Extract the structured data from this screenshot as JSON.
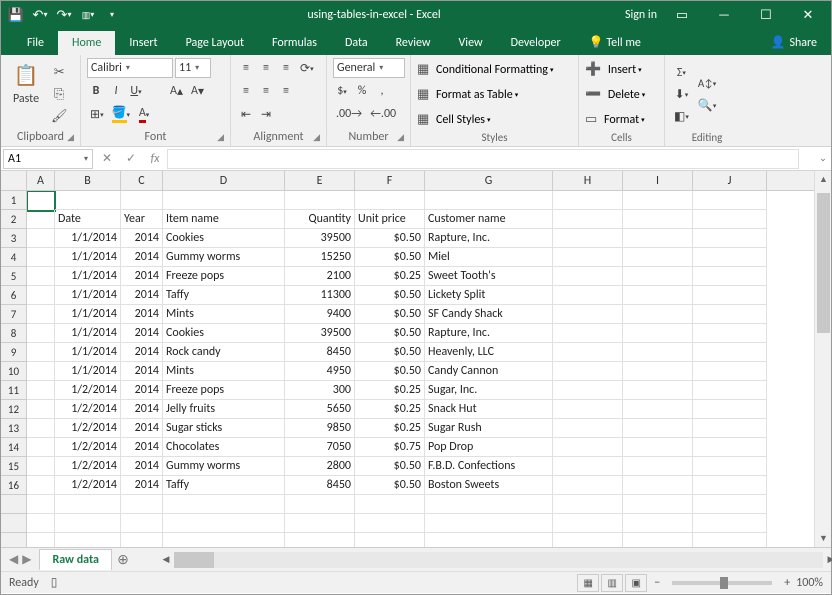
{
  "title": "using-tables-in-excel - Excel",
  "signin": "Sign in",
  "menu": {
    "file": "File",
    "home": "Home",
    "insert": "Insert",
    "pagelayout": "Page Layout",
    "formulas": "Formulas",
    "data": "Data",
    "review": "Review",
    "view": "View",
    "developer": "Developer",
    "tellme": "Tell me",
    "share": "Share"
  },
  "ribbon": {
    "clipboard": {
      "label": "Clipboard",
      "paste": "Paste"
    },
    "font": {
      "label": "Font",
      "name": "Calibri",
      "size": "11"
    },
    "alignment": {
      "label": "Alignment"
    },
    "number": {
      "label": "Number",
      "format": "General"
    },
    "styles": {
      "label": "Styles",
      "cond": "Conditional Formatting",
      "table": "Format as Table",
      "cell": "Cell Styles"
    },
    "cells": {
      "label": "Cells",
      "insert": "Insert",
      "delete": "Delete",
      "format": "Format"
    },
    "editing": {
      "label": "Editing"
    }
  },
  "namebox": "A1",
  "fx": "fx",
  "cols": [
    {
      "l": "A",
      "w": 28
    },
    {
      "l": "B",
      "w": 66
    },
    {
      "l": "C",
      "w": 42
    },
    {
      "l": "D",
      "w": 122
    },
    {
      "l": "E",
      "w": 70
    },
    {
      "l": "F",
      "w": 70
    },
    {
      "l": "G",
      "w": 128
    },
    {
      "l": "H",
      "w": 70
    },
    {
      "l": "I",
      "w": 70
    },
    {
      "l": "J",
      "w": 74
    }
  ],
  "headers": {
    "date": "Date",
    "year": "Year",
    "item": "Item name",
    "qty": "Quantity",
    "price": "Unit price",
    "cust": "Customer name"
  },
  "rows": [
    {
      "n": 3,
      "date": "1/1/2014",
      "year": "2014",
      "item": "Cookies",
      "qty": "39500",
      "price": "$0.50",
      "cust": "Rapture, Inc."
    },
    {
      "n": 4,
      "date": "1/1/2014",
      "year": "2014",
      "item": "Gummy worms",
      "qty": "15250",
      "price": "$0.50",
      "cust": "Miel"
    },
    {
      "n": 5,
      "date": "1/1/2014",
      "year": "2014",
      "item": "Freeze pops",
      "qty": "2100",
      "price": "$0.25",
      "cust": "Sweet Tooth's"
    },
    {
      "n": 6,
      "date": "1/1/2014",
      "year": "2014",
      "item": "Taffy",
      "qty": "11300",
      "price": "$0.50",
      "cust": "Lickety Split"
    },
    {
      "n": 7,
      "date": "1/1/2014",
      "year": "2014",
      "item": "Mints",
      "qty": "9400",
      "price": "$0.50",
      "cust": "SF Candy Shack"
    },
    {
      "n": 8,
      "date": "1/1/2014",
      "year": "2014",
      "item": "Cookies",
      "qty": "39500",
      "price": "$0.50",
      "cust": "Rapture, Inc."
    },
    {
      "n": 9,
      "date": "1/1/2014",
      "year": "2014",
      "item": "Rock candy",
      "qty": "8450",
      "price": "$0.50",
      "cust": "Heavenly, LLC"
    },
    {
      "n": 10,
      "date": "1/1/2014",
      "year": "2014",
      "item": "Mints",
      "qty": "4950",
      "price": "$0.50",
      "cust": "Candy Cannon"
    },
    {
      "n": 11,
      "date": "1/2/2014",
      "year": "2014",
      "item": "Freeze pops",
      "qty": "300",
      "price": "$0.25",
      "cust": "Sugar, Inc."
    },
    {
      "n": 12,
      "date": "1/2/2014",
      "year": "2014",
      "item": "Jelly fruits",
      "qty": "5650",
      "price": "$0.25",
      "cust": "Snack Hut"
    },
    {
      "n": 13,
      "date": "1/2/2014",
      "year": "2014",
      "item": "Sugar sticks",
      "qty": "9850",
      "price": "$0.25",
      "cust": "Sugar Rush"
    },
    {
      "n": 14,
      "date": "1/2/2014",
      "year": "2014",
      "item": "Chocolates",
      "qty": "7050",
      "price": "$0.75",
      "cust": "Pop Drop"
    },
    {
      "n": 15,
      "date": "1/2/2014",
      "year": "2014",
      "item": "Gummy worms",
      "qty": "2800",
      "price": "$0.50",
      "cust": "F.B.D. Confections"
    },
    {
      "n": 16,
      "date": "1/2/2014",
      "year": "2014",
      "item": "Taffy",
      "qty": "8450",
      "price": "$0.50",
      "cust": "Boston Sweets"
    }
  ],
  "sheet": "Raw data",
  "status": {
    "ready": "Ready",
    "zoom": "100%"
  }
}
